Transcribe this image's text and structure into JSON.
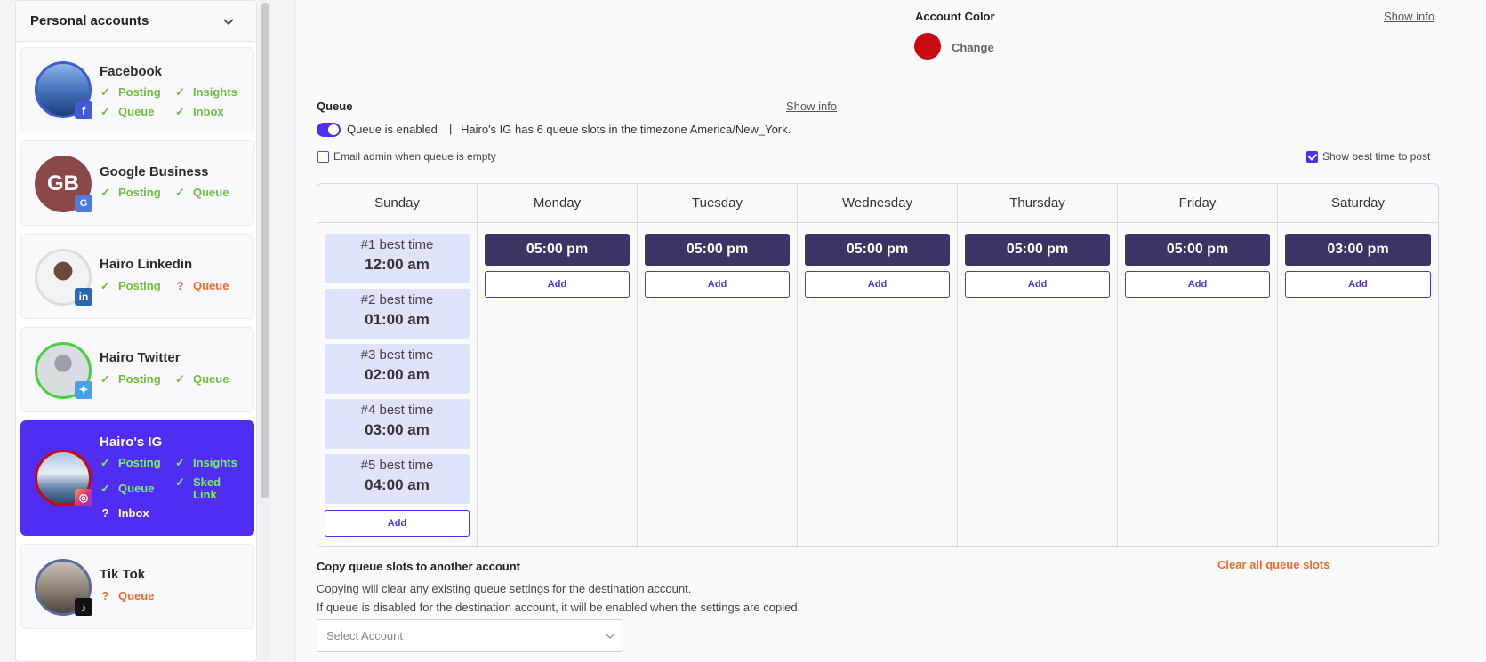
{
  "sidebar": {
    "section_title": "Personal accounts",
    "accounts": [
      {
        "name": "Facebook",
        "initials": "",
        "perms": [
          {
            "label": "Posting",
            "status": "ok"
          },
          {
            "label": "Insights",
            "status": "ok"
          },
          {
            "label": "Queue",
            "status": "ok"
          },
          {
            "label": "Inbox",
            "status": "ok"
          }
        ]
      },
      {
        "name": "Google Business",
        "initials": "GB",
        "perms": [
          {
            "label": "Posting",
            "status": "ok"
          },
          {
            "label": "Queue",
            "status": "ok"
          }
        ]
      },
      {
        "name": "Hairo Linkedin",
        "initials": "",
        "perms": [
          {
            "label": "Posting",
            "status": "ok"
          },
          {
            "label": "Queue",
            "status": "warn"
          }
        ]
      },
      {
        "name": "Hairo Twitter",
        "initials": "",
        "perms": [
          {
            "label": "Posting",
            "status": "ok"
          },
          {
            "label": "Queue",
            "status": "ok"
          }
        ]
      },
      {
        "name": "Hairo's IG",
        "initials": "",
        "perms": [
          {
            "label": "Posting",
            "status": "ok"
          },
          {
            "label": "Insights",
            "status": "ok"
          },
          {
            "label": "Queue",
            "status": "ok"
          },
          {
            "label": "Sked Link",
            "status": "ok"
          },
          {
            "label": "Inbox",
            "status": "warn"
          }
        ]
      },
      {
        "name": "Tik Tok",
        "initials": "",
        "perms": [
          {
            "label": "Queue",
            "status": "warn"
          }
        ]
      }
    ]
  },
  "account_color": {
    "label": "Account Color",
    "change_label": "Change",
    "color": "#c8090f",
    "show_info": "Show info"
  },
  "queue": {
    "label": "Queue",
    "show_info": "Show info",
    "enabled_label": "Queue is enabled",
    "separator": "|",
    "summary": "Hairo's IG has 6 queue slots in the timezone America/New_York.",
    "email_admin_label": "Email admin when queue is empty",
    "show_best_time_label": "Show best time to post",
    "add_label": "Add",
    "days": [
      {
        "name": "Sunday",
        "slots": [],
        "best_times": [
          {
            "label": "#1 best time",
            "time": "12:00 am"
          },
          {
            "label": "#2 best time",
            "time": "01:00 am"
          },
          {
            "label": "#3 best time",
            "time": "02:00 am"
          },
          {
            "label": "#4 best time",
            "time": "03:00 am"
          },
          {
            "label": "#5 best time",
            "time": "04:00 am"
          }
        ]
      },
      {
        "name": "Monday",
        "slots": [
          "05:00 pm"
        ],
        "best_times": []
      },
      {
        "name": "Tuesday",
        "slots": [
          "05:00 pm"
        ],
        "best_times": []
      },
      {
        "name": "Wednesday",
        "slots": [
          "05:00 pm"
        ],
        "best_times": []
      },
      {
        "name": "Thursday",
        "slots": [
          "05:00 pm"
        ],
        "best_times": []
      },
      {
        "name": "Friday",
        "slots": [
          "05:00 pm"
        ],
        "best_times": []
      },
      {
        "name": "Saturday",
        "slots": [
          "03:00 pm"
        ],
        "best_times": []
      }
    ]
  },
  "copy": {
    "title": "Copy queue slots to another account",
    "clear_all": "Clear all queue slots",
    "note1": "Copying will clear any existing queue settings for the destination account.",
    "note2": "If queue is disabled for the destination account, it will be enabled when the settings are copied.",
    "select_placeholder": "Select Account"
  },
  "colors": {
    "accent": "#4f2ef2",
    "slot_bg": "#3b3465",
    "ok": "#6fbf3c",
    "warn": "#f06a2a"
  }
}
